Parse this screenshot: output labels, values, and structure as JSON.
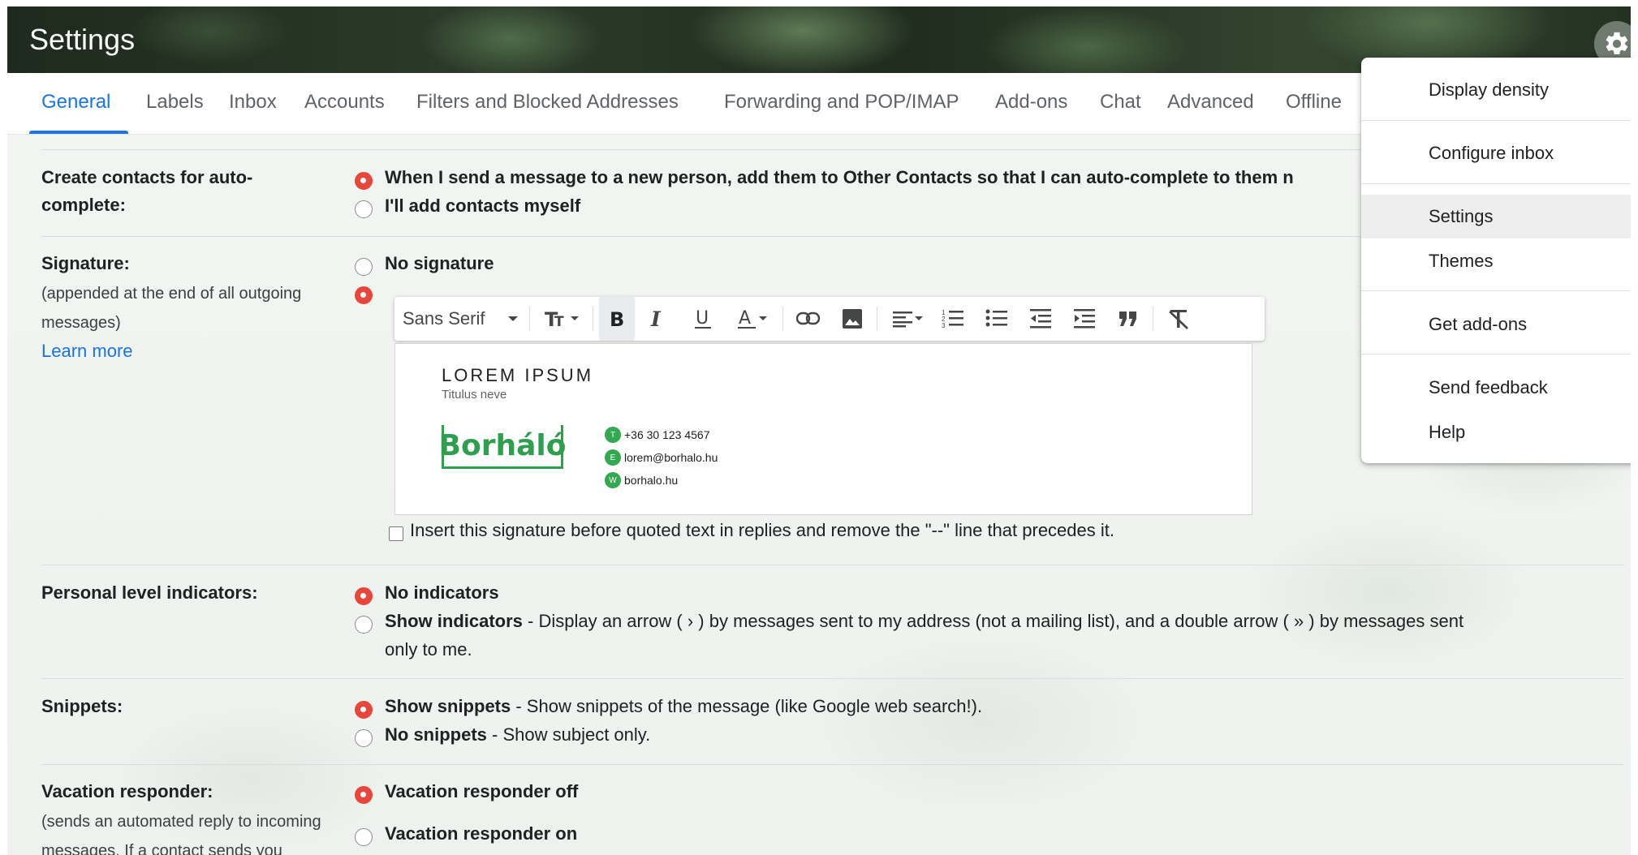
{
  "header": {
    "title": "Settings"
  },
  "tabs": [
    {
      "label": "General",
      "active": true
    },
    {
      "label": "Labels"
    },
    {
      "label": "Inbox"
    },
    {
      "label": "Accounts"
    },
    {
      "label": "Filters and Blocked Addresses"
    },
    {
      "label": "Forwarding and POP/IMAP"
    },
    {
      "label": "Add-ons"
    },
    {
      "label": "Chat"
    },
    {
      "label": "Advanced"
    },
    {
      "label": "Offline"
    }
  ],
  "sections": {
    "contacts": {
      "label": "Create contacts for auto-complete:",
      "label_line1": "Create contacts for auto-",
      "label_line2": "complete:",
      "opt1": "When I send a message to a new person, add them to Other Contacts so that I can auto-complete to them n",
      "opt2": "I'll add contacts myself",
      "selected": 1
    },
    "signature": {
      "label": "Signature:",
      "sub1": "(appended at the end of all outgoing",
      "sub2": "messages)",
      "learn_more": "Learn more",
      "opt_none": "No signature",
      "font": "Sans Serif",
      "editor": {
        "name": "LOREM IPSUM",
        "title": "Titulus neve",
        "logo": "Borháló",
        "phone_badge": "T",
        "phone": "+36 30 123 4567",
        "email_badge": "E",
        "email": "lorem@borhalo.hu",
        "web_badge": "W",
        "web": "borhalo.hu"
      },
      "insert_before": "Insert this signature before quoted text in replies and remove the \"--\" line that precedes it."
    },
    "indicators": {
      "label": "Personal level indicators:",
      "opt1": "No indicators",
      "opt2_bold": "Show indicators",
      "opt2_text": " - Display an arrow ( › ) by messages sent to my address (not a mailing list), and a double arrow ( » ) by messages sent",
      "opt2_cont": "only to me."
    },
    "snippets": {
      "label": "Snippets:",
      "opt1_bold": "Show snippets",
      "opt1_text": " - Show snippets of the message (like Google web search!).",
      "opt2_bold": "No snippets",
      "opt2_text": " - Show subject only."
    },
    "vacation": {
      "label": "Vacation responder:",
      "sub1": "(sends an automated reply to incoming",
      "sub2": "messages. If a contact sends you",
      "opt1": "Vacation responder off",
      "opt2": "Vacation responder on"
    }
  },
  "menu": {
    "items": [
      {
        "label": "Display density"
      },
      {
        "label": "Configure inbox"
      },
      {
        "label": "Settings",
        "selected": true
      },
      {
        "label": "Themes"
      },
      {
        "label": "Get add-ons"
      },
      {
        "label": "Send feedback"
      },
      {
        "label": "Help"
      }
    ]
  },
  "colors": {
    "accent": "#1a73e8",
    "radio_selected": "#e8453c",
    "logo_green": "#2e9e4f"
  }
}
